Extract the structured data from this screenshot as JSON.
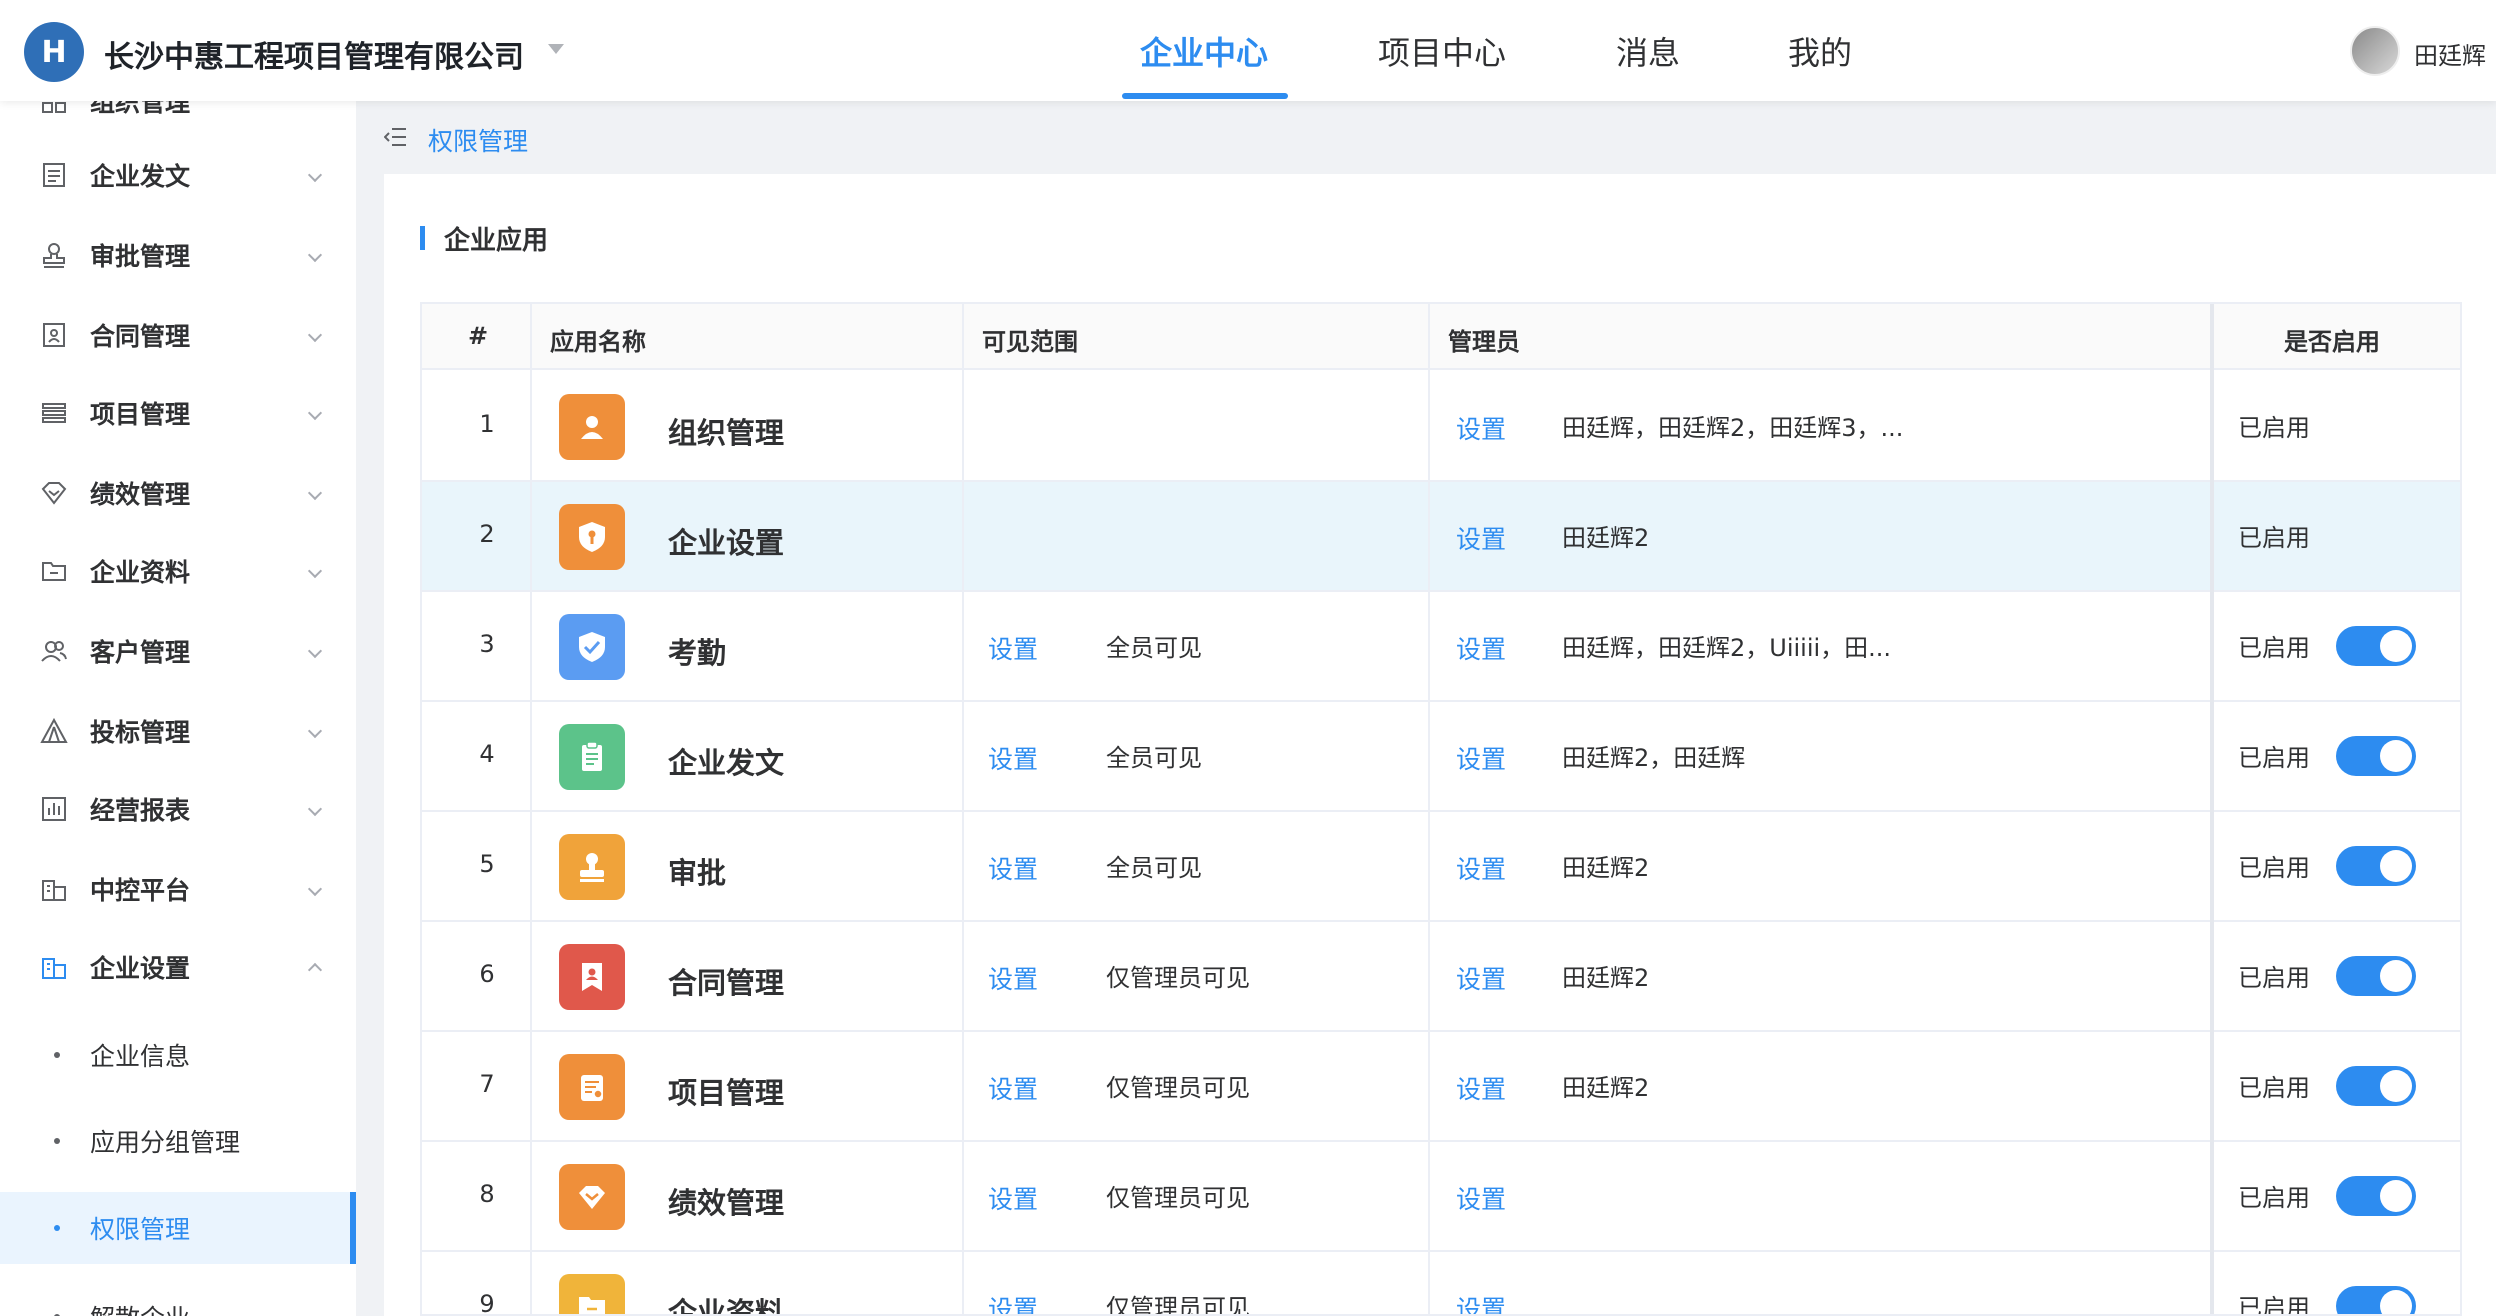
{
  "header": {
    "company": "长沙中惠工程项目管理有限公司",
    "nav": [
      "企业中心",
      "项目中心",
      "消息",
      "我的"
    ],
    "active_nav": 0,
    "user": "田廷辉"
  },
  "sidebar": {
    "partial_top": "组织管理",
    "items": [
      "企业发文",
      "审批管理",
      "合同管理",
      "项目管理",
      "绩效管理",
      "企业资料",
      "客户管理",
      "投标管理",
      "经营报表",
      "中控平台",
      "企业设置"
    ],
    "expanded_item": "企业设置",
    "sub_items": [
      "企业信息",
      "应用分组管理",
      "权限管理"
    ],
    "active_sub": "权限管理",
    "partial_bottom": "解散企业"
  },
  "breadcrumb": "权限管理",
  "section_title": "企业应用",
  "table": {
    "headers": [
      "#",
      "应用名称",
      "可见范围",
      "管理员",
      "是否启用"
    ],
    "set_label": "设置",
    "rows": [
      {
        "num": "1",
        "name": "组织管理",
        "icon_color": "#ef8f3a",
        "visibility": "",
        "admins": "田廷辉，田廷辉2，田廷辉3，...",
        "status": "已启用",
        "toggle": false
      },
      {
        "num": "2",
        "name": "企业设置",
        "icon_color": "#ef8f3a",
        "visibility": "",
        "admins": "田廷辉2",
        "status": "已启用",
        "toggle": false
      },
      {
        "num": "3",
        "name": "考勤",
        "icon_color": "#5b9cf2",
        "visibility": "全员可见",
        "admins": "田廷辉，田廷辉2，Uiiiii，田...",
        "status": "已启用",
        "toggle": true
      },
      {
        "num": "4",
        "name": "企业发文",
        "icon_color": "#5cc38a",
        "visibility": "全员可见",
        "admins": "田廷辉2，田廷辉",
        "status": "已启用",
        "toggle": true
      },
      {
        "num": "5",
        "name": "审批",
        "icon_color": "#f0a33a",
        "visibility": "全员可见",
        "admins": "田廷辉2",
        "status": "已启用",
        "toggle": true
      },
      {
        "num": "6",
        "name": "合同管理",
        "icon_color": "#e0584b",
        "visibility": "仅管理员可见",
        "admins": "田廷辉2",
        "status": "已启用",
        "toggle": true
      },
      {
        "num": "7",
        "name": "项目管理",
        "icon_color": "#ef8f3a",
        "visibility": "仅管理员可见",
        "admins": "田廷辉2",
        "status": "已启用",
        "toggle": true
      },
      {
        "num": "8",
        "name": "绩效管理",
        "icon_color": "#ef8f3a",
        "visibility": "仅管理员可见",
        "admins": "",
        "status": "已启用",
        "toggle": true
      },
      {
        "num": "9",
        "name": "企业资料",
        "icon_color": "#f0b43a",
        "visibility": "仅管理员可见",
        "admins": "",
        "status": "已启用",
        "toggle": true
      }
    ]
  },
  "colors": {
    "accent": "#2d8cf0",
    "highlight_row": "#e9f5fb"
  }
}
